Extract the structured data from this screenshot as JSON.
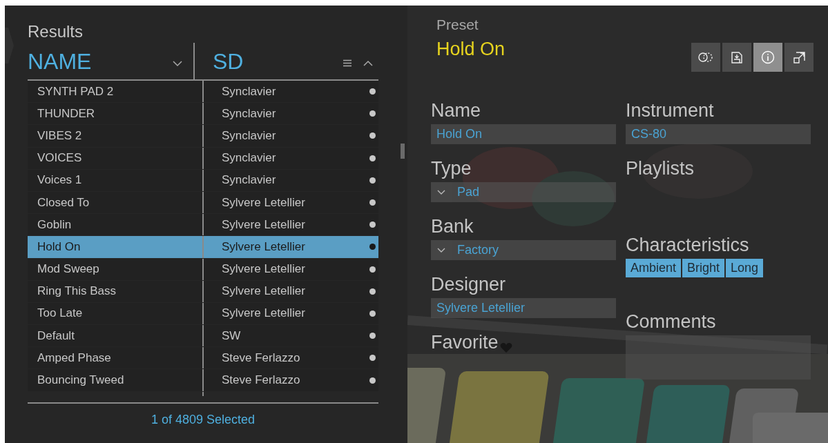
{
  "results": {
    "title": "Results",
    "columns": [
      {
        "label": "NAME",
        "kind": "sort-down"
      },
      {
        "label": "SD",
        "kind": "menu-sort-up"
      }
    ],
    "rows": [
      {
        "name": "SYNTH PAD 2",
        "designer": "Synclavier",
        "selected": false
      },
      {
        "name": "THUNDER",
        "designer": "Synclavier",
        "selected": false
      },
      {
        "name": "VIBES 2",
        "designer": "Synclavier",
        "selected": false
      },
      {
        "name": "VOICES",
        "designer": "Synclavier",
        "selected": false
      },
      {
        "name": "Voices 1",
        "designer": "Synclavier",
        "selected": false
      },
      {
        "name": "Closed To",
        "designer": "Sylvere Letellier",
        "selected": false
      },
      {
        "name": "Goblin",
        "designer": "Sylvere Letellier",
        "selected": false
      },
      {
        "name": "Hold On",
        "designer": "Sylvere Letellier",
        "selected": true
      },
      {
        "name": "Mod Sweep",
        "designer": "Sylvere Letellier",
        "selected": false
      },
      {
        "name": "Ring This Bass",
        "designer": "Sylvere Letellier",
        "selected": false
      },
      {
        "name": "Too Late",
        "designer": "Sylvere Letellier",
        "selected": false
      },
      {
        "name": "Default",
        "designer": "SW",
        "selected": false
      },
      {
        "name": "Amped Phase",
        "designer": "Steve Ferlazzo",
        "selected": false
      },
      {
        "name": "Bouncing Tweed",
        "designer": "Steve Ferlazzo",
        "selected": false
      }
    ],
    "footer": "1 of 4809 Selected"
  },
  "preset": {
    "label": "Preset",
    "name": "Hold On",
    "toolbar": [
      {
        "kind": "dotted-circle",
        "selected": false
      },
      {
        "kind": "save",
        "selected": false
      },
      {
        "kind": "info",
        "selected": true
      },
      {
        "kind": "expand",
        "selected": false
      }
    ],
    "name_label": "Name",
    "name_value": "Hold On",
    "type_label": "Type",
    "type_value": "Pad",
    "bank_label": "Bank",
    "bank_value": "Factory",
    "designer_label": "Designer",
    "designer_value": "Sylvere Letellier",
    "favorite_label": "Favorite",
    "favorite": false,
    "instrument_label": "Instrument",
    "instrument_value": "CS-80",
    "playlists_label": "Playlists",
    "characteristics_label": "Characteristics",
    "characteristics": [
      "Ambient",
      "Bright",
      "Long"
    ],
    "comments_label": "Comments"
  }
}
